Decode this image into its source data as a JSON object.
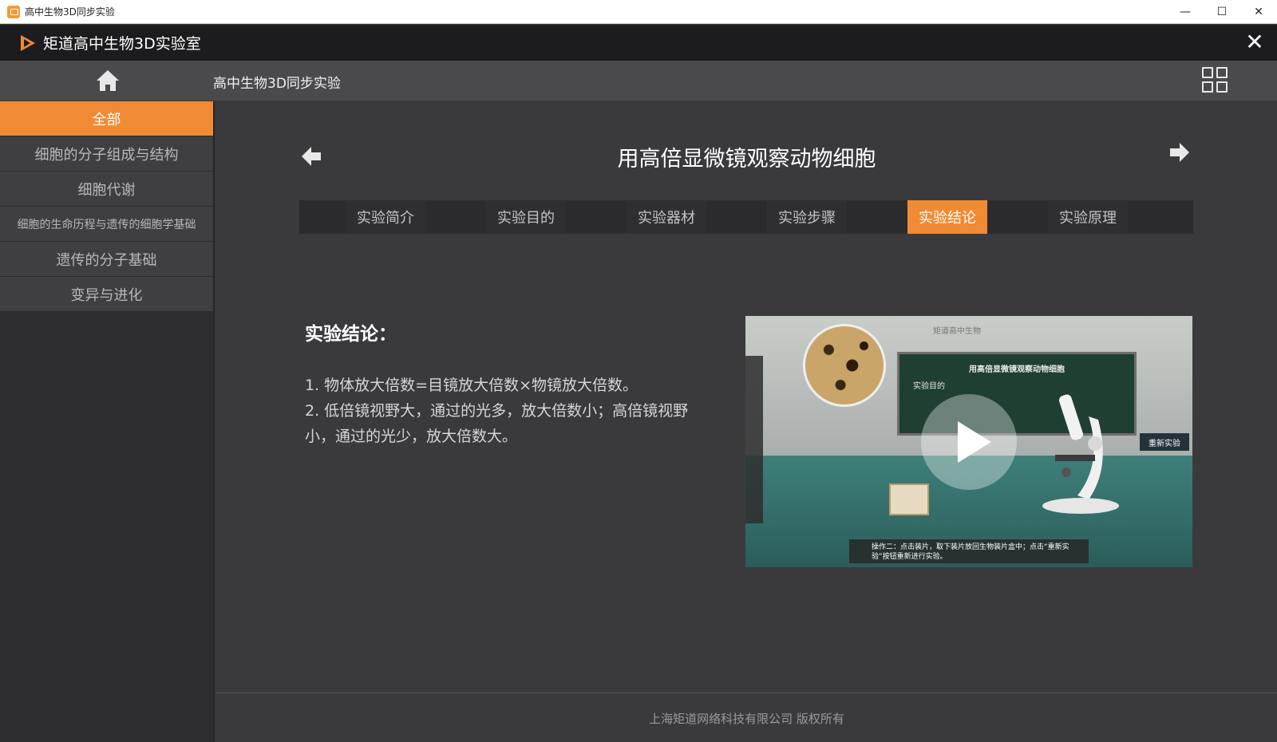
{
  "window": {
    "title": "高中生物3D同步实验",
    "controls": [
      "—",
      "☐",
      "✕"
    ]
  },
  "header": {
    "app_title": "矩道高中生物3D实验室",
    "close_label": "✕"
  },
  "nav": {
    "title": "高中生物3D同步实验"
  },
  "sidebar": {
    "items": [
      {
        "label": "全部",
        "active": true
      },
      {
        "label": "细胞的分子组成与结构",
        "active": false
      },
      {
        "label": "细胞代谢",
        "active": false
      },
      {
        "label": "细胞的生命历程与遗传的细胞学基础",
        "active": false
      },
      {
        "label": "遗传的分子基础",
        "active": false
      },
      {
        "label": "变异与进化",
        "active": false
      }
    ]
  },
  "experiment": {
    "title": "用高倍显微镜观察动物细胞",
    "tabs": [
      {
        "label": "实验简介",
        "active": false
      },
      {
        "label": "实验目的",
        "active": false
      },
      {
        "label": "实验器材",
        "active": false
      },
      {
        "label": "实验步骤",
        "active": false
      },
      {
        "label": "实验结论",
        "active": true
      },
      {
        "label": "实验原理",
        "active": false
      }
    ],
    "content_heading": "实验结论：",
    "content_lines": [
      "1. 物体放大倍数=目镜放大倍数×物镜放大倍数。",
      "2. 低倍镜视野大，通过的光多，放大倍数小；高倍镜视野小，通过的光少，放大倍数大。"
    ]
  },
  "video": {
    "brand": "矩道高中生物",
    "board_title": "用高倍显微镜观察动物细胞",
    "board_sub": "实验目的",
    "restart_label": "重新实验",
    "caption": "操作二：点击装片，取下装片放回生物装片盒中；点击“重新实验”按钮重新进行实验。"
  },
  "footer": {
    "copyright": "上海矩道网络科技有限公司  版权所有"
  },
  "colors": {
    "accent": "#f08a33",
    "header_bg": "#1c1c1e",
    "nav_bg": "#4a4a4d",
    "main_bg": "#3a3a3d"
  },
  "icons": {
    "home": "home-icon",
    "grid": "grid-icon",
    "arrow_left": "arrow-left-icon",
    "arrow_right": "arrow-right-icon",
    "close": "close-icon"
  }
}
